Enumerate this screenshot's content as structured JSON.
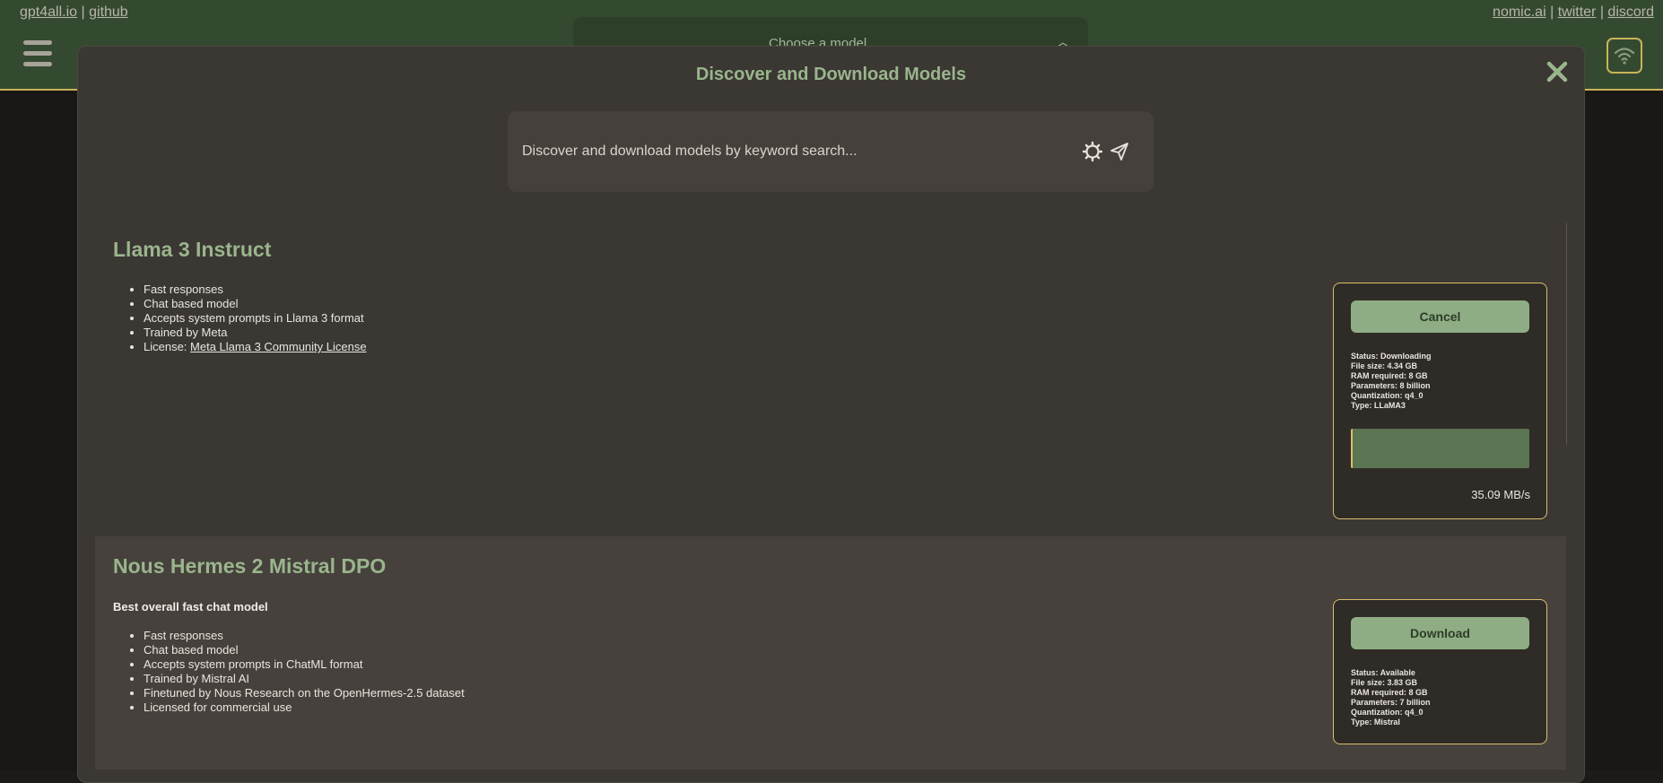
{
  "header": {
    "left_links": [
      "gpt4all.io",
      "github"
    ],
    "right_links": [
      "nomic.ai",
      "twitter",
      "discord"
    ],
    "separator": "|",
    "model_select_placeholder": "Choose a model..."
  },
  "dialog": {
    "title": "Discover and Download Models",
    "search_placeholder": "Discover and download models by keyword search..."
  },
  "models": [
    {
      "name": "Llama 3 Instruct",
      "features": [
        "Fast responses",
        "Chat based model",
        "Accepts system prompts in Llama 3 format",
        "Trained by Meta"
      ],
      "license_prefix": "License: ",
      "license_link": "Meta Llama 3 Community License",
      "button": "Cancel",
      "info": [
        "Status: Downloading",
        "File size: 4.34 GB",
        "RAM required: 8 GB",
        "Parameters: 8 billion",
        "Quantization: q4_0",
        "Type: LLaMA3"
      ],
      "progress_fraction": 0.01,
      "speed": "35.09 MB/s"
    },
    {
      "name": "Nous Hermes 2 Mistral DPO",
      "tagline": "Best overall fast chat model",
      "features": [
        "Fast responses",
        "Chat based model",
        "Accepts system prompts in ChatML format",
        "Trained by Mistral AI",
        "Finetuned by Nous Research on the OpenHermes-2.5 dataset",
        "Licensed for commercial use"
      ],
      "button": "Download",
      "info": [
        "Status: Available",
        "File size: 3.83 GB",
        "RAM required: 8 GB",
        "Parameters: 7 billion",
        "Quantization: q4_0",
        "Type: Mistral"
      ]
    }
  ],
  "colors": {
    "accent_green": "#9ab58d",
    "button_green": "#8fad84",
    "border_gold": "#d9bf6a",
    "header_green": "#344a30"
  },
  "icons": [
    "hamburger-icon",
    "chevron-up-icon",
    "wifi-icon",
    "close-icon",
    "gear-icon",
    "send-icon"
  ]
}
